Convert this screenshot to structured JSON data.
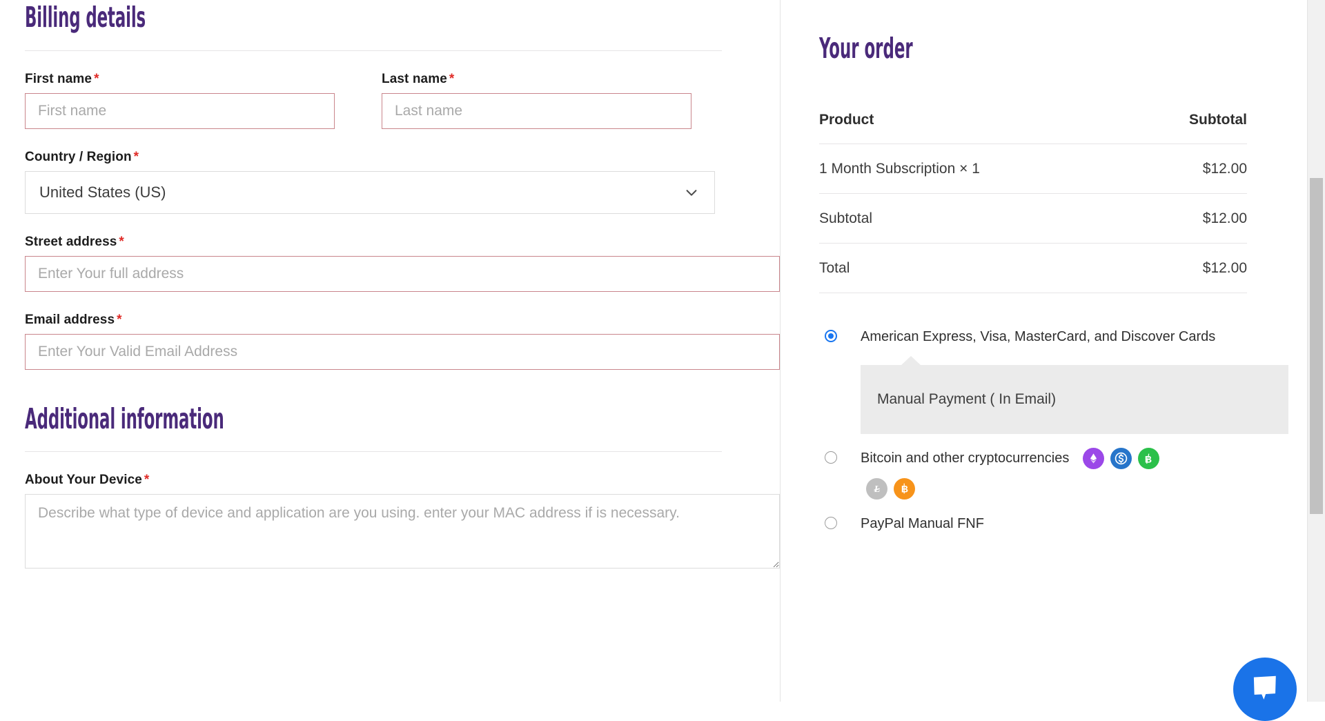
{
  "billing": {
    "heading": "Billing details",
    "first_name": {
      "label": "First name",
      "required": "*",
      "placeholder": "First name",
      "value": ""
    },
    "last_name": {
      "label": "Last name",
      "required": "*",
      "placeholder": "Last name",
      "value": ""
    },
    "country": {
      "label": "Country / Region",
      "required": "*",
      "selected": "United States (US)"
    },
    "street": {
      "label": "Street address",
      "required": "*",
      "placeholder": "Enter Your full address",
      "value": ""
    },
    "email": {
      "label": "Email address",
      "required": "*",
      "placeholder": "Enter Your Valid Email Address",
      "value": ""
    }
  },
  "additional": {
    "heading": "Additional information",
    "device": {
      "label": "About Your Device",
      "required": "*",
      "placeholder": "Describe what type of device and application are you using. enter your MAC address if is necessary.",
      "value": ""
    }
  },
  "order": {
    "heading": "Your order",
    "columns": {
      "product": "Product",
      "subtotal": "Subtotal"
    },
    "rows": [
      {
        "label": "1 Month Subscription × 1",
        "amount": "$12.00"
      },
      {
        "label": "Subtotal",
        "amount": "$12.00"
      },
      {
        "label": "Total",
        "amount": "$12.00"
      }
    ],
    "payment_methods": [
      {
        "id": "cards",
        "label": "American Express, Visa, MasterCard, and Discover Cards",
        "selected": true,
        "info": "Manual Payment ( In Email)"
      },
      {
        "id": "crypto",
        "label": "Bitcoin and other cryptocurrencies",
        "selected": false,
        "icons_row1": [
          "ethereum-icon",
          "usdc-icon",
          "bitcoin-cash-icon"
        ],
        "icons_row2": [
          "litecoin-icon",
          "bitcoin-icon"
        ]
      },
      {
        "id": "paypal",
        "label": "PayPal Manual FNF",
        "selected": false
      }
    ]
  },
  "colors": {
    "heading_purple": "#4a2a7a",
    "required_red": "#e02b27",
    "radio_blue": "#1976f0",
    "chat_blue": "#1a73e8",
    "info_box_gray": "#ebebeb",
    "ethereum": "#9b48e8",
    "usdc": "#2775ca",
    "bitcoin_cash": "#2bc04a",
    "litecoin": "#bfbfbf",
    "bitcoin": "#f7931a"
  },
  "chat": {
    "icon": "chat-bubble-icon"
  }
}
